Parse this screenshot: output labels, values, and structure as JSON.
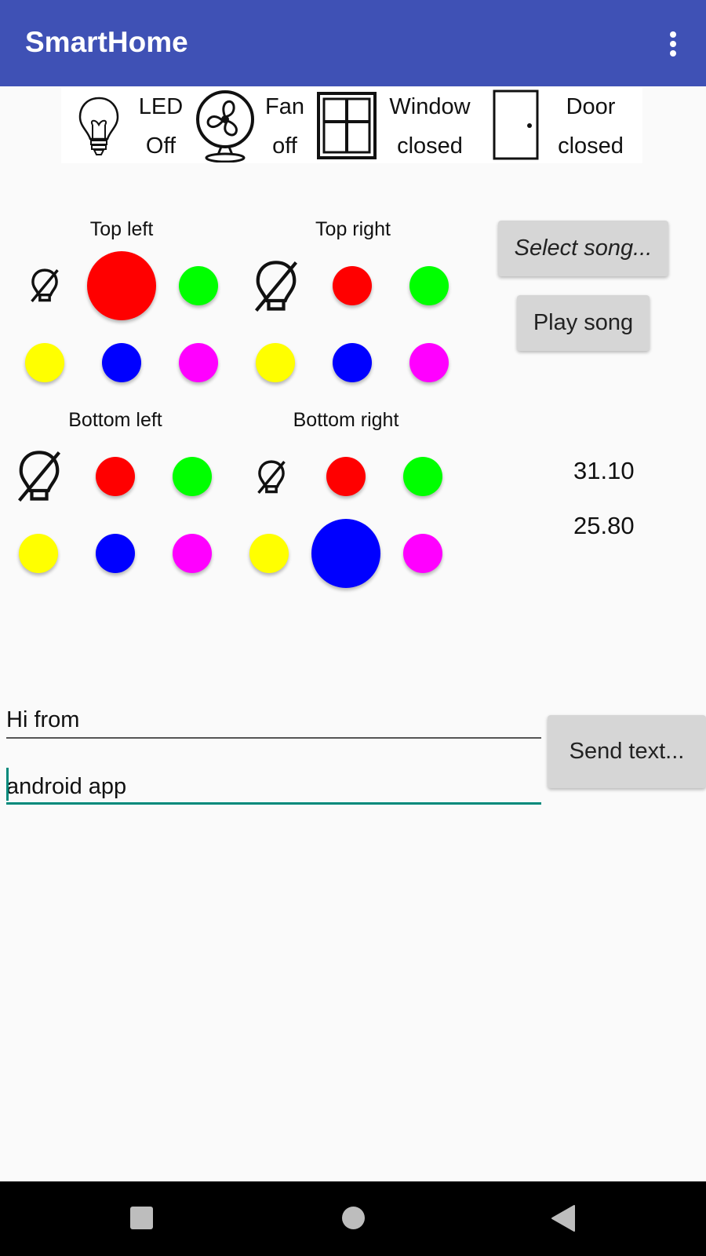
{
  "app_bar": {
    "title": "SmartHome",
    "menu_icon": "more-vert-icon"
  },
  "status": {
    "led": {
      "label": "LED",
      "state": "Off",
      "icon": "lightbulb-icon"
    },
    "fan": {
      "label": "Fan",
      "state": "off",
      "icon": "fan-icon"
    },
    "window": {
      "label": "Window",
      "state": "closed",
      "icon": "window-icon"
    },
    "door": {
      "label": "Door",
      "state": "closed",
      "icon": "door-icon"
    }
  },
  "zones": {
    "top_left": {
      "label": "Top left",
      "selected": "red"
    },
    "top_right": {
      "label": "Top right",
      "selected": "off"
    },
    "bottom_left": {
      "label": "Bottom left",
      "selected": "off"
    },
    "bottom_right": {
      "label": "Bottom right",
      "selected": "blue"
    }
  },
  "colors": {
    "red": "#ff0000",
    "green": "#00ff00",
    "yellow": "#ffff00",
    "blue": "#0000ff",
    "magenta": "#ff00ff",
    "accent": "#3f51b5",
    "field_focus": "#00897b"
  },
  "music": {
    "select_label": "Select song...",
    "play_label": "Play song"
  },
  "sensors": {
    "humidity": {
      "value": "31.10",
      "icon": "humidity-thermometer-icon"
    },
    "temperature": {
      "value": "25.80",
      "icon": "celsius-thermometer-icon"
    }
  },
  "messaging": {
    "line1_value": "Hi from",
    "line2_value": "android app",
    "send_label": "Send text..."
  },
  "nav": {
    "recents": "square-recents-icon",
    "home": "circle-home-icon",
    "back": "triangle-back-icon"
  }
}
